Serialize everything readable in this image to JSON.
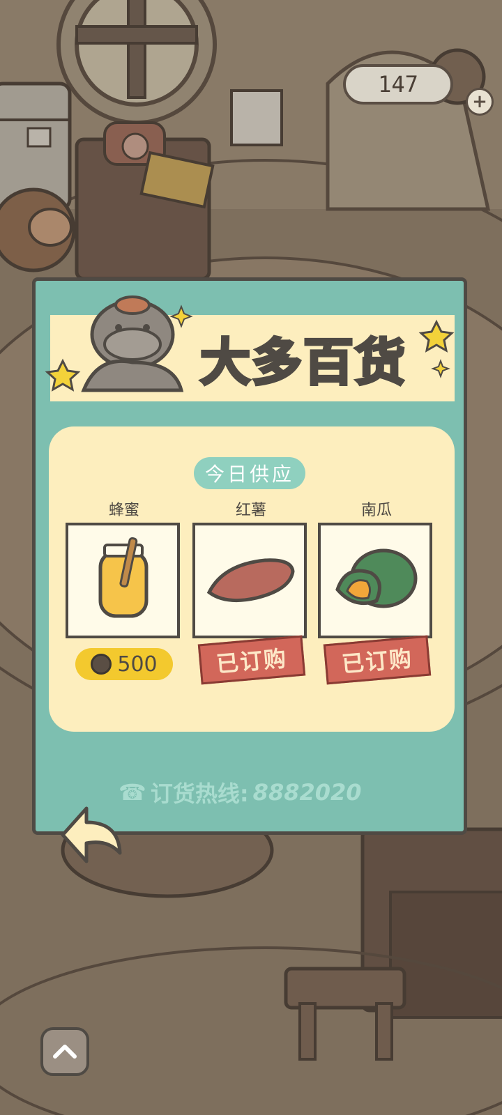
{
  "hud": {
    "coin_count": "147",
    "add_icon": "plus-icon"
  },
  "shop": {
    "title": "大多百货",
    "supply_label": "今日供应",
    "items": [
      {
        "name": "蜂蜜",
        "icon": "honey-jar-icon",
        "price": "500",
        "status": ""
      },
      {
        "name": "红薯",
        "icon": "sweet-potato-icon",
        "price": "",
        "status": "已订购"
      },
      {
        "name": "南瓜",
        "icon": "pumpkin-icon",
        "price": "",
        "status": "已订购"
      }
    ],
    "hotline_label": "订货热线:",
    "hotline_number": "8882020"
  },
  "colors": {
    "panel": "#7dbfb0",
    "banner": "#fdeebe",
    "price_pill": "#f3c92e",
    "ordered_stamp": "#d2675a"
  }
}
